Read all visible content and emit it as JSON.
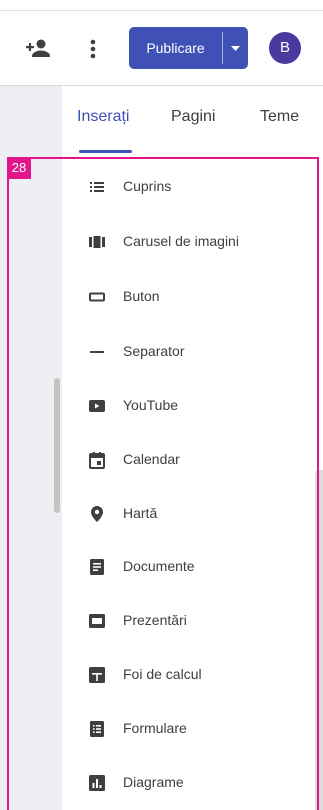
{
  "header": {
    "publish_label": "Publicare",
    "avatar_letter": "B"
  },
  "tabs": [
    {
      "label": "Inserați",
      "active": true
    },
    {
      "label": "Pagini",
      "active": false
    },
    {
      "label": "Teme",
      "active": false
    }
  ],
  "guide_label": "28",
  "items": [
    {
      "label": "Cuprins",
      "icon": "table-of-contents-icon"
    },
    {
      "label": "Carusel de imagini",
      "icon": "carousel-icon"
    },
    {
      "label": "Buton",
      "icon": "button-icon"
    },
    {
      "label": "Separator",
      "icon": "divider-icon"
    },
    {
      "label": "YouTube",
      "icon": "youtube-icon"
    },
    {
      "label": "Calendar",
      "icon": "calendar-icon"
    },
    {
      "label": "Hartă",
      "icon": "map-pin-icon"
    },
    {
      "label": "Documente",
      "icon": "docs-icon"
    },
    {
      "label": "Prezentări",
      "icon": "slides-icon"
    },
    {
      "label": "Foi de calcul",
      "icon": "sheets-icon"
    },
    {
      "label": "Formulare",
      "icon": "forms-icon"
    },
    {
      "label": "Diagrame",
      "icon": "charts-icon"
    }
  ],
  "colors": {
    "accent": "#3f51b5",
    "guide": "#e2168b",
    "icon": "#3c4043"
  }
}
